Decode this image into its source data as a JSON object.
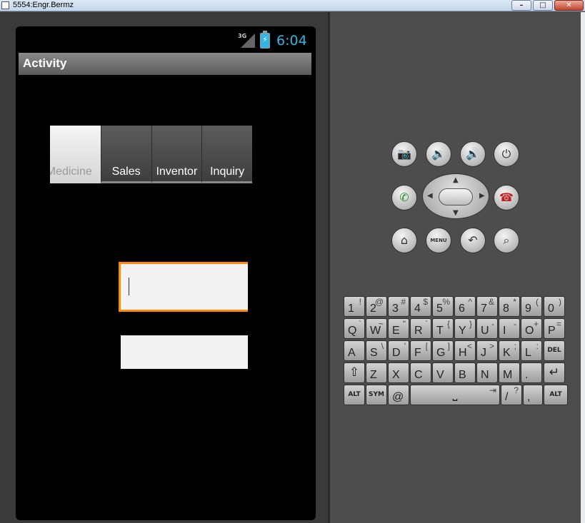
{
  "window": {
    "title": "5554:Engr.Bermz",
    "minimize_glyph": "–",
    "maximize_glyph": "□",
    "close_glyph": "✕"
  },
  "status_bar": {
    "network": "3G",
    "battery_glyph": "⚡",
    "time": "6:04"
  },
  "app": {
    "title": "Activity",
    "tabs": [
      {
        "label": "Medicine",
        "selected": true
      },
      {
        "label": "Sales",
        "selected": false
      },
      {
        "label": "Inventor",
        "selected": false
      },
      {
        "label": "Inquiry",
        "selected": false
      }
    ],
    "field_1": {
      "value": "",
      "focused": true
    },
    "field_2": {
      "value": "",
      "focused": false
    }
  },
  "hardware_buttons": {
    "camera": "camera-icon",
    "volume_down": "volume-down-icon",
    "volume_up": "volume-up-icon",
    "power": "power-icon",
    "call": "call-icon",
    "end_call": "end-call-icon",
    "home": "home-icon",
    "menu_label": "MENU",
    "back": "back-icon",
    "search": "search-icon"
  },
  "keyboard": {
    "row1": [
      {
        "main": "1",
        "alt": "!"
      },
      {
        "main": "2",
        "alt": "@"
      },
      {
        "main": "3",
        "alt": "#"
      },
      {
        "main": "4",
        "alt": "$"
      },
      {
        "main": "5",
        "alt": "%"
      },
      {
        "main": "6",
        "alt": "^"
      },
      {
        "main": "7",
        "alt": "&"
      },
      {
        "main": "8",
        "alt": "*"
      },
      {
        "main": "9",
        "alt": "("
      },
      {
        "main": "0",
        "alt": ")"
      }
    ],
    "row2": [
      {
        "main": "Q",
        "alt": "`"
      },
      {
        "main": "W",
        "alt": "~"
      },
      {
        "main": "E",
        "alt": "\""
      },
      {
        "main": "R",
        "alt": "`"
      },
      {
        "main": "T",
        "alt": "{"
      },
      {
        "main": "Y",
        "alt": "}"
      },
      {
        "main": "U",
        "alt": "-"
      },
      {
        "main": "I",
        "alt": "-"
      },
      {
        "main": "O",
        "alt": "+"
      },
      {
        "main": "P",
        "alt": "="
      }
    ],
    "row3": [
      {
        "main": "A",
        "alt": ""
      },
      {
        "main": "S",
        "alt": "\\"
      },
      {
        "main": "D",
        "alt": "'"
      },
      {
        "main": "F",
        "alt": "["
      },
      {
        "main": "G",
        "alt": "]"
      },
      {
        "main": "H",
        "alt": "<"
      },
      {
        "main": "J",
        "alt": ">"
      },
      {
        "main": "K",
        "alt": ";"
      },
      {
        "main": "L",
        "alt": ":"
      },
      {
        "main": "DEL",
        "alt": ""
      }
    ],
    "row4": [
      {
        "main": "⇧",
        "alt": ""
      },
      {
        "main": "Z",
        "alt": ""
      },
      {
        "main": "X",
        "alt": ""
      },
      {
        "main": "C",
        "alt": ""
      },
      {
        "main": "V",
        "alt": ""
      },
      {
        "main": "B",
        "alt": ""
      },
      {
        "main": "N",
        "alt": ""
      },
      {
        "main": "M",
        "alt": ""
      },
      {
        "main": ".",
        "alt": ""
      },
      {
        "main": "↵",
        "alt": ""
      }
    ],
    "row5": [
      {
        "main": "ALT",
        "alt": ""
      },
      {
        "main": "SYM",
        "alt": ""
      },
      {
        "main": "@",
        "alt": ""
      },
      {
        "main": "⎵",
        "alt": "⇥"
      },
      {
        "main": "/",
        "alt": "?"
      },
      {
        "main": ",",
        "alt": ""
      },
      {
        "main": "ALT",
        "alt": ""
      }
    ]
  }
}
